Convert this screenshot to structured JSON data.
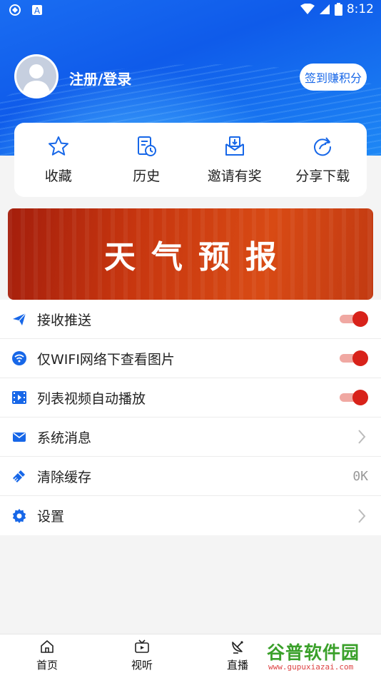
{
  "status_bar": {
    "time": "8:12"
  },
  "profile": {
    "login_label": "注册/登录",
    "signin_button": "签到赚积分"
  },
  "quick_actions": [
    {
      "label": "收藏",
      "icon": "star-icon"
    },
    {
      "label": "历史",
      "icon": "history-icon"
    },
    {
      "label": "邀请有奖",
      "icon": "invite-icon"
    },
    {
      "label": "分享下载",
      "icon": "share-icon"
    }
  ],
  "banner": {
    "text": "天气预报"
  },
  "settings": {
    "push": {
      "label": "接收推送",
      "on": true
    },
    "wifi_images": {
      "label": "仅WIFI网络下查看图片",
      "on": true
    },
    "autoplay": {
      "label": "列表视频自动播放",
      "on": true
    },
    "messages": {
      "label": "系统消息"
    },
    "clear_cache": {
      "label": "清除缓存",
      "value": "0K"
    },
    "settings": {
      "label": "设置"
    }
  },
  "tabbar": [
    {
      "label": "首页",
      "icon": "home-icon"
    },
    {
      "label": "视听",
      "icon": "tv-icon"
    },
    {
      "label": "直播",
      "icon": "satellite-dish-icon"
    }
  ],
  "watermark": {
    "title": "谷普软件园",
    "url": "www.gupuxiazai.com"
  },
  "colors": {
    "accent": "#1767e8",
    "toggle": "#d8221a",
    "banner": "#c7360f"
  }
}
